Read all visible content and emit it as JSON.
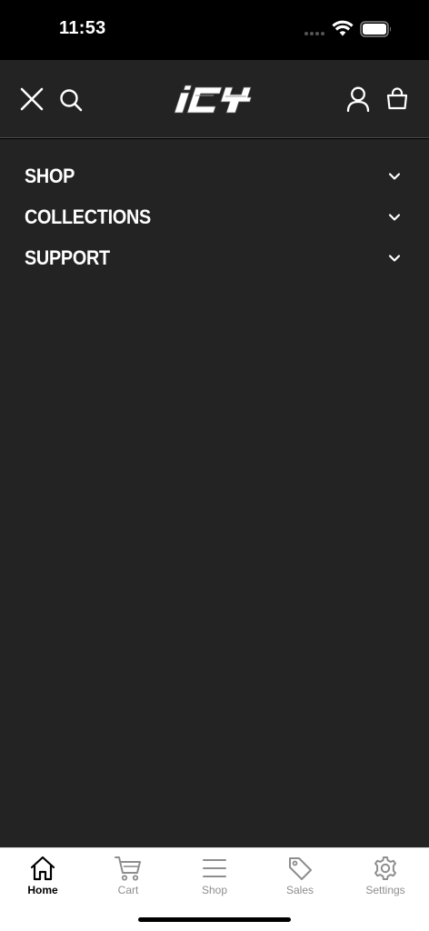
{
  "status_bar": {
    "time": "11:53"
  },
  "header": {
    "logo_text": "ICY",
    "icons": [
      "close-icon",
      "search-icon",
      "user-icon",
      "bag-icon"
    ]
  },
  "menu": {
    "items": [
      {
        "label": "SHOP"
      },
      {
        "label": "COLLECTIONS"
      },
      {
        "label": "SUPPORT"
      }
    ]
  },
  "tab_bar": {
    "tabs": [
      {
        "label": "Home",
        "icon": "home-icon",
        "active": true
      },
      {
        "label": "Cart",
        "icon": "cart-icon",
        "active": false
      },
      {
        "label": "Shop",
        "icon": "menu-icon",
        "active": false
      },
      {
        "label": "Sales",
        "icon": "tag-icon",
        "active": false
      },
      {
        "label": "Settings",
        "icon": "gear-icon",
        "active": false
      }
    ]
  },
  "colors": {
    "background": "#232323",
    "status_bar": "#000000",
    "tab_bar": "#ffffff",
    "text_primary": "#ffffff",
    "tab_active": "#000000",
    "tab_inactive": "#8e8e8e"
  }
}
